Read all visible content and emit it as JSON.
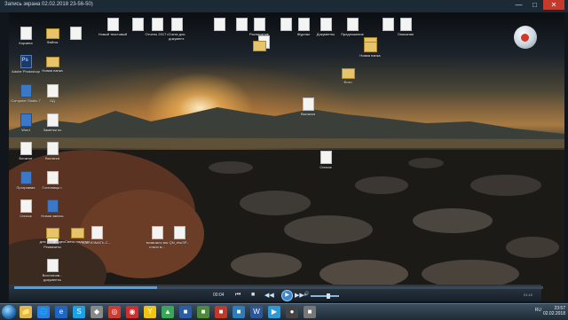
{
  "window": {
    "title": "Запись экрана 02.02.2018 23-56-50)",
    "min": "—",
    "max": "□",
    "close": "✕"
  },
  "desktop_icons": [
    {
      "label": "Корзина",
      "kind": "doc"
    },
    {
      "label": "Файлы",
      "kind": "folder"
    },
    {
      "label": "",
      "kind": "doc"
    },
    {
      "label": "Adobe Photoshop",
      "kind": "ps"
    },
    {
      "label": "Новая папка",
      "kind": "folder"
    },
    {
      "label": "Computer Studio 7",
      "kind": "blue"
    },
    {
      "label": "БД",
      "kind": "doc"
    },
    {
      "label": "Word",
      "kind": "blue"
    },
    {
      "label": "Заметки по",
      "kind": "doc"
    },
    {
      "label": "Блокнот",
      "kind": "doc"
    },
    {
      "label": "Выписка",
      "kind": "doc"
    },
    {
      "label": "Программа",
      "kind": "blue"
    },
    {
      "label": "Гостиницы г.",
      "kind": "doc"
    },
    {
      "label": "Список",
      "kind": "doc"
    },
    {
      "label": "Новая запись",
      "kind": "blue"
    },
    {
      "label": "Реквизиты",
      "kind": "doc"
    },
    {
      "label": "для рост видео",
      "kind": "folder"
    },
    {
      "label": "Свечи наделки",
      "kind": "folder"
    },
    {
      "label": "КАК ИЗМАТЬ С...",
      "kind": "doc"
    },
    {
      "label": "Восстанов... документы",
      "kind": "doc"
    },
    {
      "label": "возможно мы стали м...",
      "kind": "doc"
    },
    {
      "label": "QN_ekuSP...",
      "kind": "doc"
    },
    {
      "label": "Новый текстовый",
      "kind": "doc"
    },
    {
      "label": "",
      "kind": "doc"
    },
    {
      "label": "Отчеты 2017 г.",
      "kind": "doc"
    },
    {
      "label": "Счета для документ.",
      "kind": "doc"
    },
    {
      "label": "",
      "kind": "doc"
    },
    {
      "label": "",
      "kind": "doc"
    },
    {
      "label": "Расписание",
      "kind": "doc"
    },
    {
      "label": "",
      "kind": "doc"
    },
    {
      "label": "Журнал",
      "kind": "doc"
    },
    {
      "label": "Документы",
      "kind": "doc"
    },
    {
      "label": "Предложение",
      "kind": "doc"
    },
    {
      "label": "Копия",
      "kind": "folder"
    },
    {
      "label": "",
      "kind": "doc"
    },
    {
      "label": "Описание",
      "kind": "doc"
    },
    {
      "label": "",
      "kind": "doc"
    },
    {
      "label": "",
      "kind": "folder"
    },
    {
      "label": "Фото",
      "kind": "folder"
    },
    {
      "label": "Выписка",
      "kind": "doc"
    },
    {
      "label": "Новая папка",
      "kind": "folder"
    },
    {
      "label": "Список",
      "kind": "doc"
    }
  ],
  "player": {
    "elapsed": "00:04",
    "seek_progress": 0.27,
    "prev": "⏮",
    "stop": "■",
    "rewind": "◀◀",
    "play": "▶",
    "ff": "▶▶",
    "next": "⏭",
    "volume_icon": "🔊",
    "volume_level": 0.6,
    "remaining": "01:10"
  },
  "taskbar": {
    "items": [
      "📁",
      "🌐",
      "e",
      "S",
      "◆",
      "◎",
      "◉",
      "Y",
      "▲",
      "■",
      "■",
      "■",
      "■",
      "W",
      "▶",
      "●",
      "■"
    ],
    "lang": "RU",
    "time": "23:57",
    "date": "02.02.2018"
  },
  "colors": {
    "accent": "#4ea3e6",
    "close": "#c43b2e"
  }
}
